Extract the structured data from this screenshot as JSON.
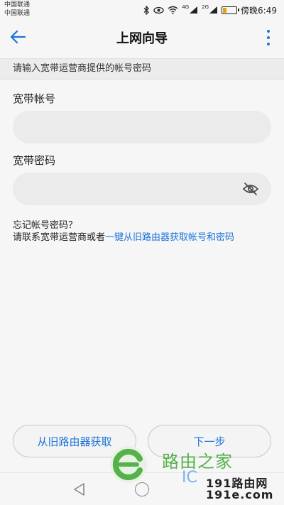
{
  "status_bar": {
    "carrier_1": "中国联通",
    "carrier_2": "中国联通",
    "net_1": "4G",
    "net_2": "2G",
    "time": "傍晚6:49"
  },
  "app_bar": {
    "title": "上网向导"
  },
  "hint": "请输入宽带运营商提供的帐号密码",
  "form": {
    "account_label": "宽带帐号",
    "account_value": "",
    "password_label": "宽带密码",
    "password_value": ""
  },
  "help": {
    "forgot": "忘记帐号密码？",
    "contact_prefix": "请联系宽带运营商或者",
    "contact_link": "一键从旧路由器获取帐号和密码"
  },
  "buttons": {
    "get_from_old": "从旧路由器获取",
    "next": "下一步"
  },
  "watermark": {
    "brand": "路由之家",
    "mark": "IC",
    "url_1": "191路由网",
    "url_2": "191e.com"
  },
  "colors": {
    "accent": "#1a73d9",
    "background": "#f6f6f6",
    "field": "#ebebeb",
    "watermark_green": "#55b14a"
  }
}
